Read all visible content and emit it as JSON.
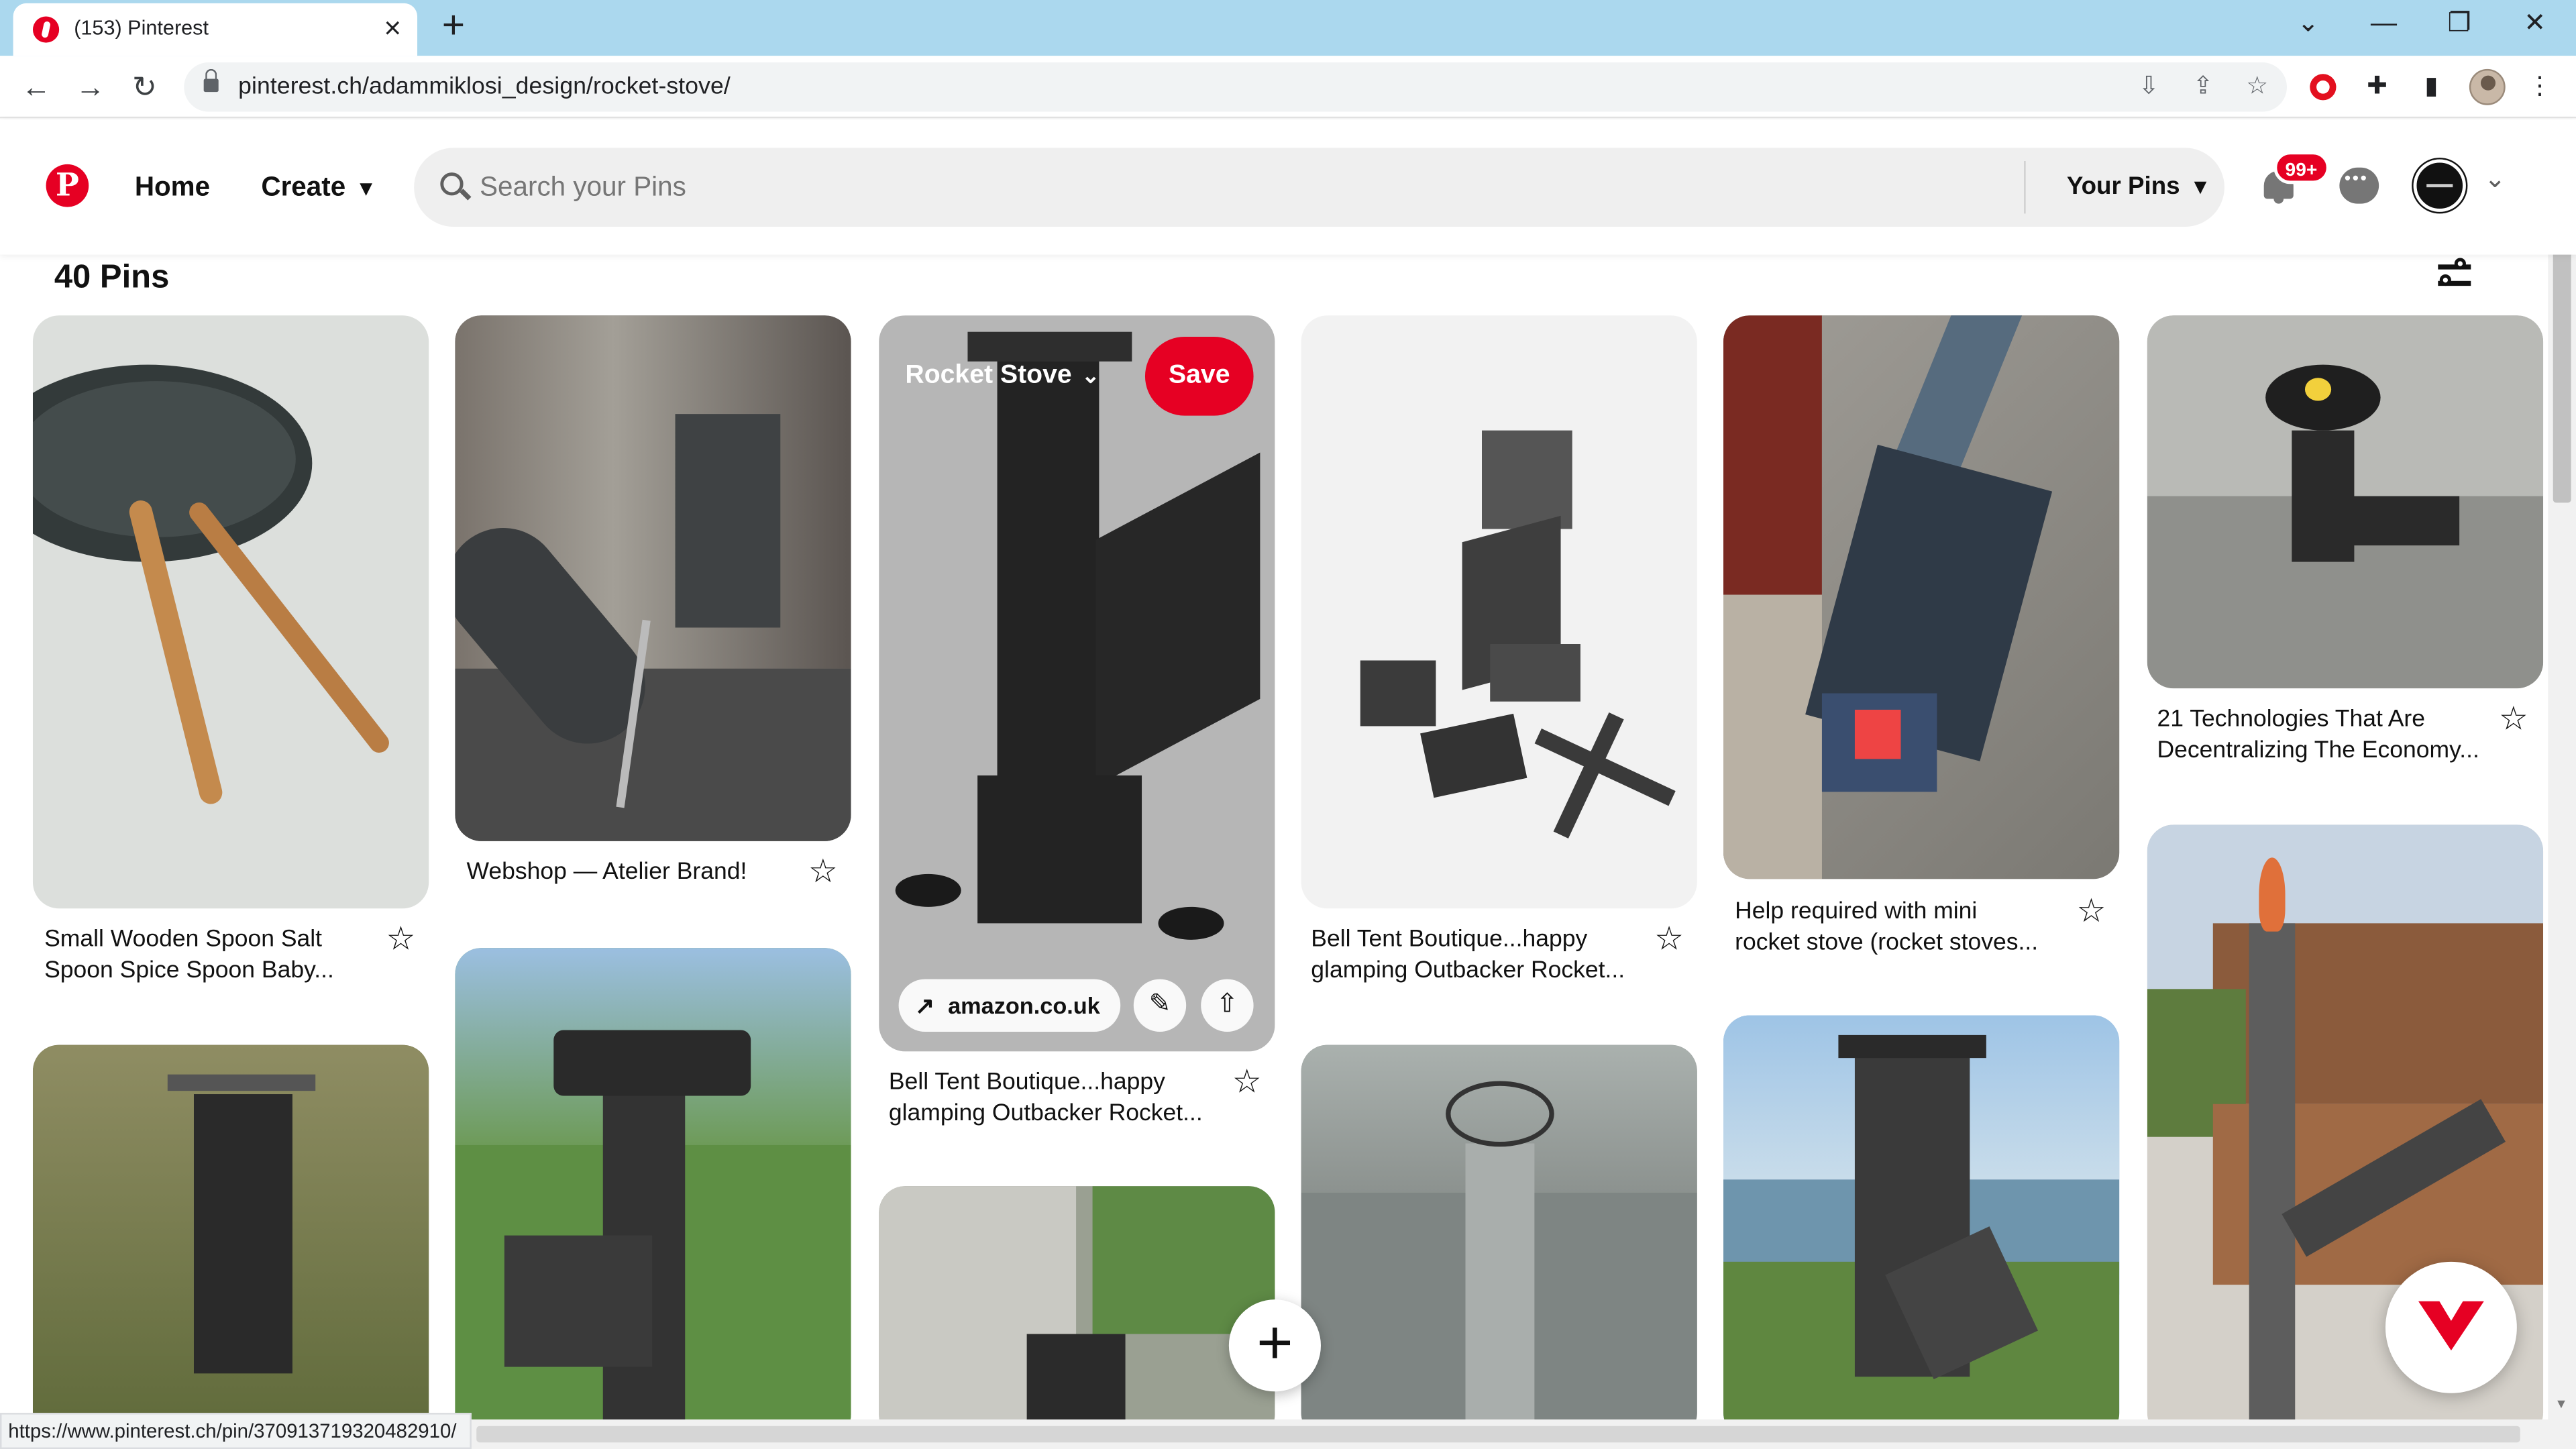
{
  "browser": {
    "tab_title": "(153) Pinterest",
    "url": "pinterest.ch/adammiklosi_design/rocket-stove/",
    "status_url": "https://www.pinterest.ch/pin/370913719320482910/"
  },
  "pinterest": {
    "nav": {
      "logo": "P",
      "home": "Home",
      "create": "Create",
      "search_placeholder": "Search your Pins",
      "your_pins": "Your Pins",
      "notification_badge": "99+"
    },
    "board": {
      "pin_count": "40 Pins"
    },
    "hover_pin": {
      "board_name": "Rocket Stove",
      "save_label": "Save",
      "domain": "amazon.co.uk"
    },
    "pins": [
      {
        "title_line1": "Small Wooden Spoon Salt",
        "title_line2": "Spoon Spice Spoon Baby..."
      },
      {
        "title_line1": "Webshop — Atelier Brand!",
        "title_line2": ""
      },
      {
        "title_line1": "Bell Tent Boutique...happy",
        "title_line2": "glamping Outbacker Rocket..."
      },
      {
        "title_line1": "Bell Tent Boutique...happy",
        "title_line2": "glamping Outbacker Rocket..."
      },
      {
        "title_line1": "Help required with mini",
        "title_line2": "rocket stove (rocket stoves..."
      },
      {
        "title_line1": "21 Technologies That Are",
        "title_line2": "Decentralizing The Economy..."
      }
    ]
  },
  "colors": {
    "brand_red": "#e60023",
    "chrome_titlebar": "#abd8ee"
  }
}
